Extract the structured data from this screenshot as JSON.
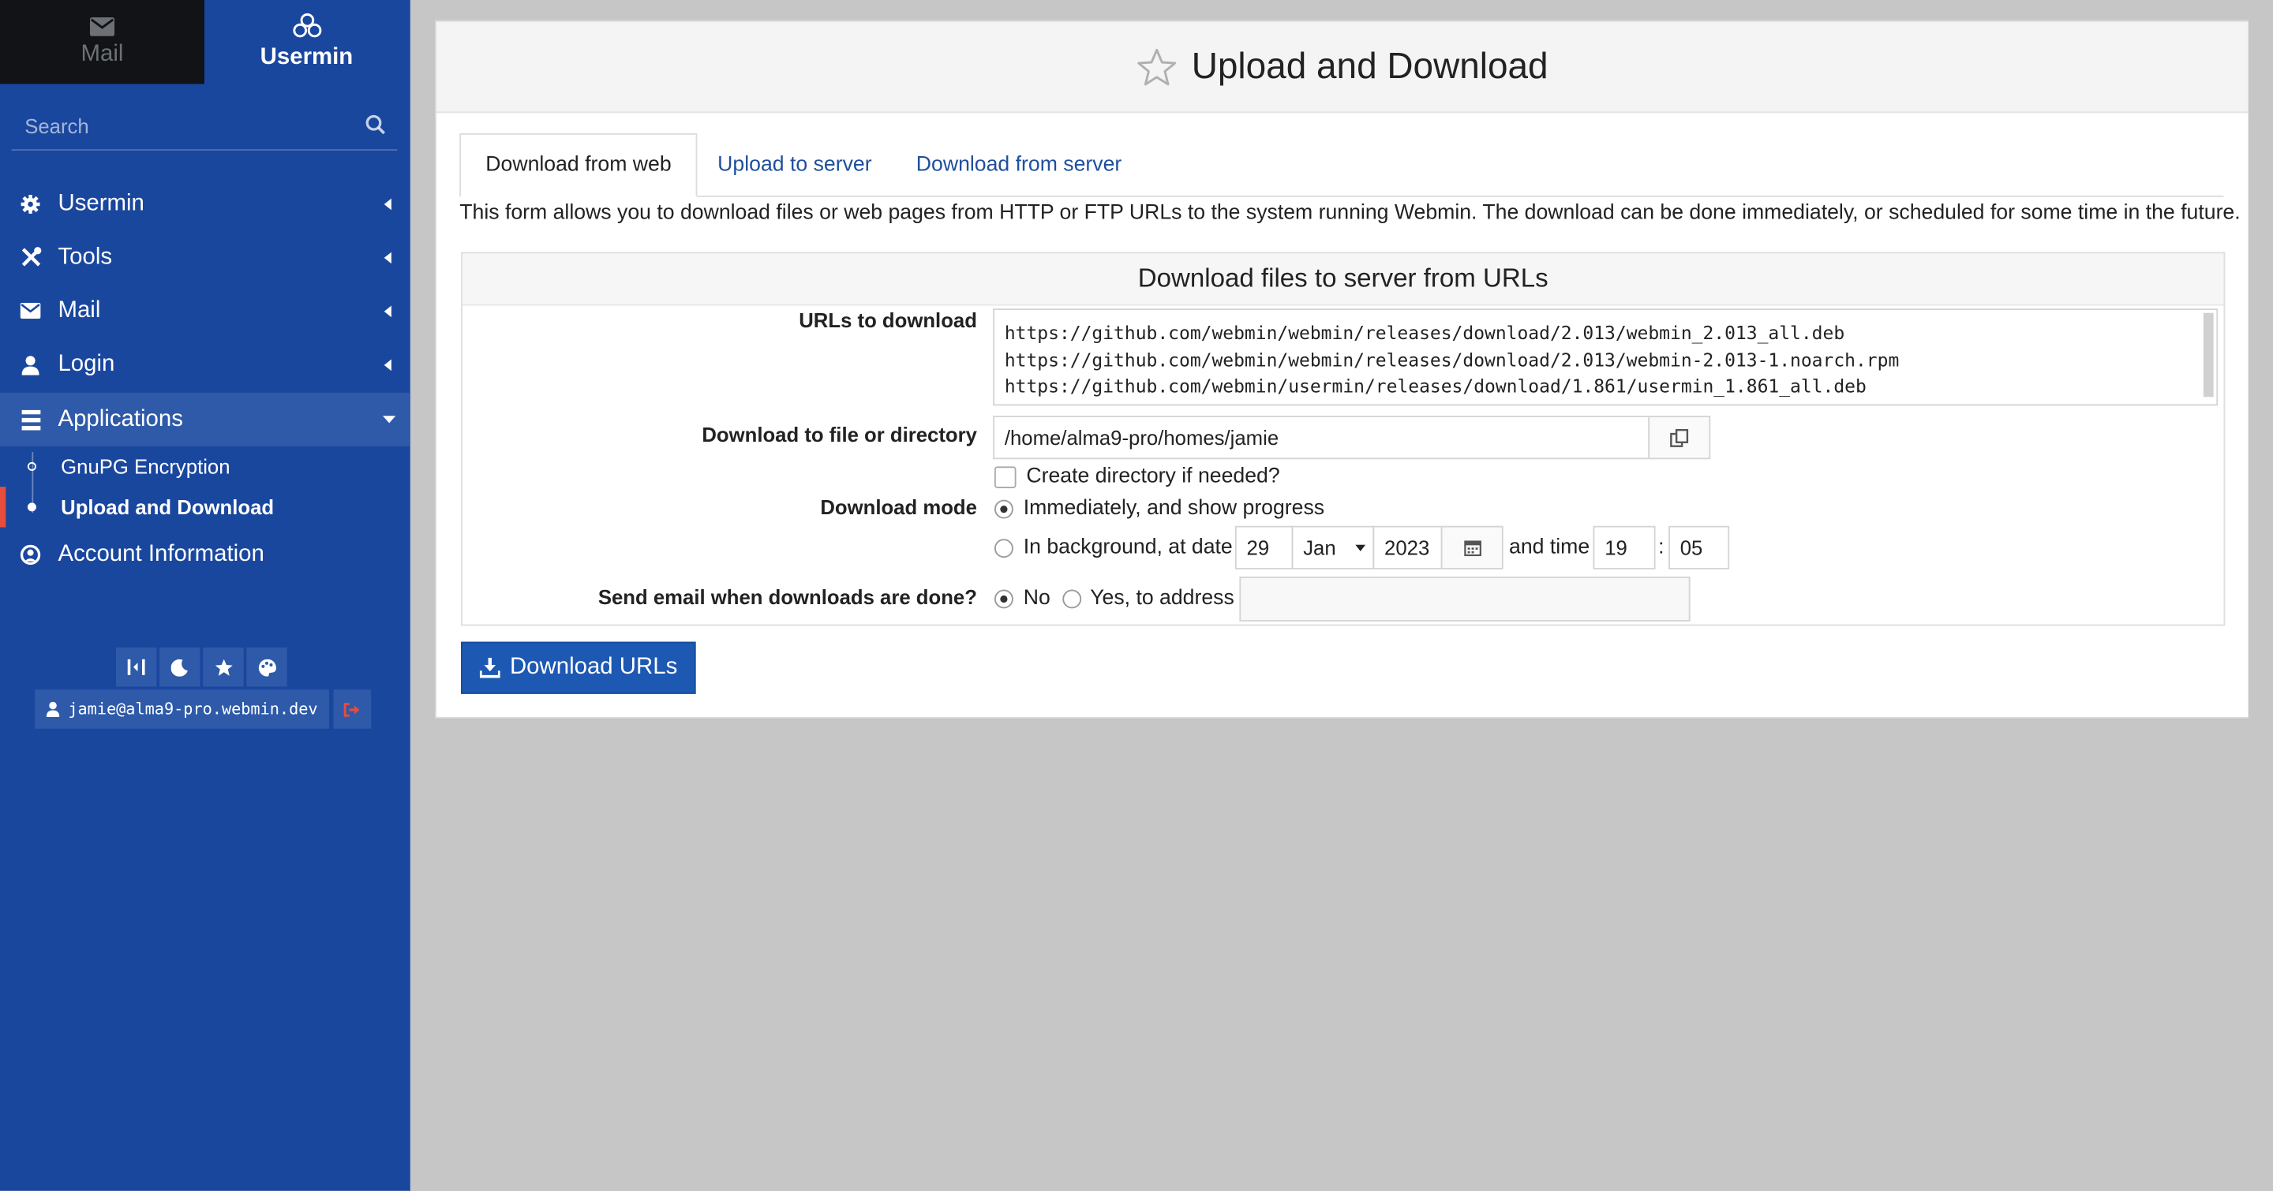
{
  "switcher": {
    "mail": "Mail",
    "usermin": "Usermin"
  },
  "search": {
    "placeholder": "Search"
  },
  "nav": [
    {
      "label": "Usermin",
      "icon": "gear-icon"
    },
    {
      "label": "Tools",
      "icon": "tools-icon"
    },
    {
      "label": "Mail",
      "icon": "envelope-icon"
    },
    {
      "label": "Login",
      "icon": "user-icon"
    },
    {
      "label": "Applications",
      "icon": "applications-icon",
      "expanded": true
    },
    {
      "label": "Account Information",
      "icon": "user-circle-icon"
    }
  ],
  "subnav": [
    {
      "label": "GnuPG Encryption"
    },
    {
      "label": "Upload and Download",
      "current": true
    }
  ],
  "footer": {
    "user": "jamie@alma9-pro.webmin.dev"
  },
  "page": {
    "title": "Upload and Download",
    "tabs": [
      "Download from web",
      "Upload to server",
      "Download from server"
    ],
    "description": "This form allows you to download files or web pages from HTTP or FTP URLs to the system running Webmin. The download can be done immediately, or scheduled for some time in the future."
  },
  "form": {
    "header": "Download files to server from URLs",
    "urls_label": "URLs to download",
    "urls": [
      "https://github.com/webmin/webmin/releases/download/2.013/webmin_2.013_all.deb",
      "https://github.com/webmin/webmin/releases/download/2.013/webmin-2.013-1.noarch.rpm",
      "https://github.com/webmin/usermin/releases/download/1.861/usermin_1.861_all.deb"
    ],
    "dest_label": "Download to file or directory",
    "dest_value": "/home/alma9-pro/homes/jamie",
    "mkdir_label": "Create directory if needed?",
    "mode_label": "Download mode",
    "mode_immediate": "Immediately, and show progress",
    "mode_background": "In background, at date",
    "date_day": "29",
    "date_month": "Jan",
    "date_year": "2023",
    "and_time": "and time",
    "time_hour": "19",
    "time_sep": ":",
    "time_min": "05",
    "email_label": "Send email when downloads are done?",
    "email_no": "No",
    "email_yes": "Yes, to address",
    "submit": "Download URLs"
  }
}
